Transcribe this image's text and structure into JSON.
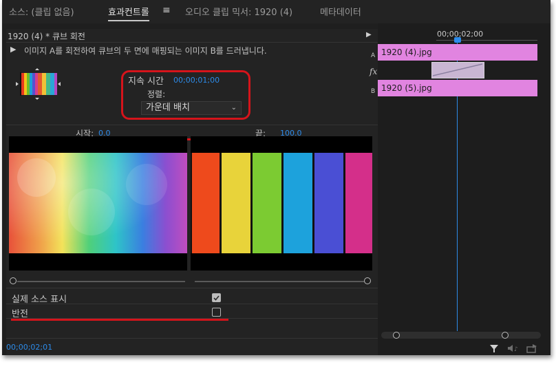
{
  "tabs": {
    "source": "소스: (클립 없음)",
    "effect_controls": "효과컨트롤",
    "audio_mixer": "오디오 클립 믹서: 1920 (4)",
    "metadata": "메타데이터"
  },
  "effect": {
    "header": "1920 (4) * 큐브 회전",
    "description": "이미지 A를 회전하여 큐브의 두 면에 매핑되는 이미지 B를 드러냅니다.",
    "duration_label": "지속 시간",
    "duration_value": "00;00;01;00",
    "alignment_label": "정렬:",
    "alignment_value": "가운데 배치",
    "start_label": "시작:",
    "start_value": "0.0",
    "end_label": "끝:",
    "end_value": "100.0",
    "show_actual_sources_label": "실제 소스 표시",
    "show_actual_sources_checked": true,
    "reverse_label": "반전",
    "reverse_checked": false,
    "current_time": "00;00;02;01"
  },
  "timeline": {
    "timecode": "00;00;02;00",
    "track_a_label": "A",
    "track_b_label": "B",
    "fx_label": "fx",
    "clip_a": "1920 (4).jpg",
    "clip_b": "1920 (5).jpg"
  },
  "icons": [
    "play-triangle-icon",
    "menu-icon",
    "panel-arrow-icon",
    "filter-icon",
    "audio-icon",
    "export-icon",
    "chevron-down-icon"
  ],
  "colors": {
    "accent_blue": "#2d8ceb",
    "annotation_red": "#d5141b",
    "clip_pink": "#e184e0",
    "playhead": "#2d8ceb"
  }
}
